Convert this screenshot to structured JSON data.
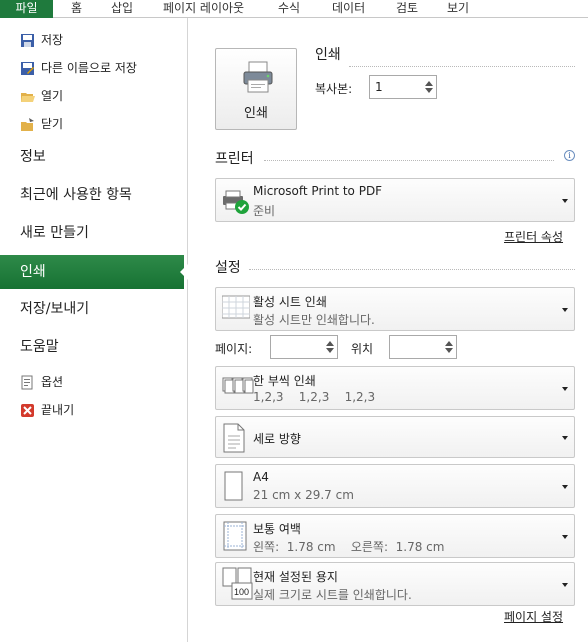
{
  "ribbon": {
    "tabs": [
      {
        "label": "파일",
        "active": true
      },
      {
        "label": "홈"
      },
      {
        "label": "삽입"
      },
      {
        "label": "페이지 레이아웃"
      },
      {
        "label": "수식"
      },
      {
        "label": "데이터"
      },
      {
        "label": "검토"
      },
      {
        "label": "보기"
      }
    ]
  },
  "nav": {
    "save": "저장",
    "save_as": "다른 이름으로 저장",
    "open": "열기",
    "close": "닫기",
    "info": "정보",
    "recent": "최근에 사용한 항목",
    "new": "새로 만들기",
    "print": "인쇄",
    "save_send": "저장/보내기",
    "help": "도움말",
    "options": "옵션",
    "exit": "끝내기"
  },
  "print": {
    "button_label": "인쇄",
    "section_title": "인쇄",
    "copies_label": "복사본:",
    "copies_value": "1"
  },
  "printer": {
    "section_title": "프린터",
    "info_icon": "i",
    "name": "Microsoft Print to PDF",
    "status": "준비",
    "properties_link": "프린터 속성"
  },
  "settings": {
    "section_title": "설정",
    "what": {
      "title": "활성 시트 인쇄",
      "desc": "활성 시트만 인쇄합니다."
    },
    "pages_label": "페이지:",
    "pages_value": "",
    "to_label": "위치",
    "to_value": "",
    "collate": {
      "title": "한 부씩 인쇄",
      "desc": "1,2,3    1,2,3    1,2,3"
    },
    "orientation": {
      "title": "세로 방향"
    },
    "paper": {
      "title": "A4",
      "desc": "21 cm x 29.7 cm"
    },
    "margins": {
      "title": "보통 여백",
      "desc": "왼쪽:  1.78 cm    오른쪽:  1.78 cm"
    },
    "scaling": {
      "title": "현재 설정된 용지",
      "desc": "실제 크기로 시트를 인쇄합니다.",
      "icon_text": "100"
    },
    "page_setup_link": "페이지 설정"
  },
  "colors": {
    "accent": "#1f7a3d",
    "active_nav": "#217346"
  }
}
